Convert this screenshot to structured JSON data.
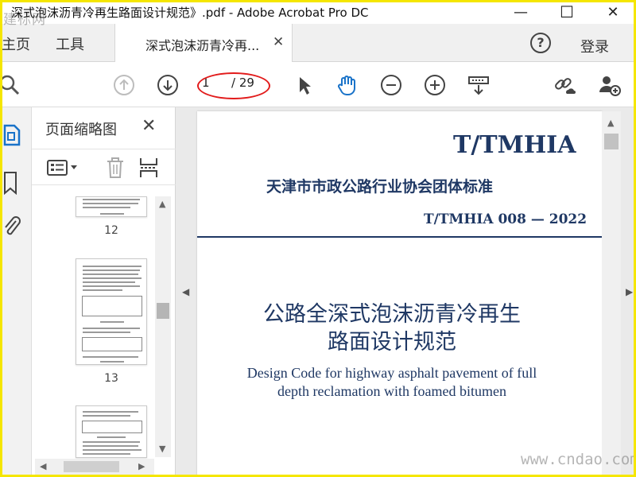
{
  "window": {
    "title": "深式泡沫沥青冷再生路面设计规范》.pdf - Adobe Acrobat Pro DC",
    "minimize": "—",
    "maximize": "☐",
    "close": "✕"
  },
  "watermarks": {
    "top_left": "建标网",
    "bottom_right": "www.cndao.com"
  },
  "menubar": {
    "home": "主页",
    "tools": "工具",
    "tab_label": "深式泡沫沥青冷再...",
    "tab_close": "✕",
    "help": "?",
    "login": "登录"
  },
  "toolbar": {
    "current_page": "1",
    "total_pages": "/ 29",
    "highlight_color": "#e21b1b"
  },
  "thumbnails": {
    "panel_title": "页面缩略图",
    "panel_close": "✕",
    "pages": [
      "12",
      "13"
    ]
  },
  "document": {
    "std_code": "T/TMHIA",
    "association": "天津市市政公路行业协会团体标准",
    "std_number": "T/TMHIA  008 — 2022",
    "title_cn_line1": "公路全深式泡沫沥青冷再生",
    "title_cn_line2": "路面设计规范",
    "title_en_line1": "Design Code for highway asphalt pavement of full",
    "title_en_line2": "depth reclamation with foamed bitumen",
    "accent_color": "#1f3864"
  }
}
